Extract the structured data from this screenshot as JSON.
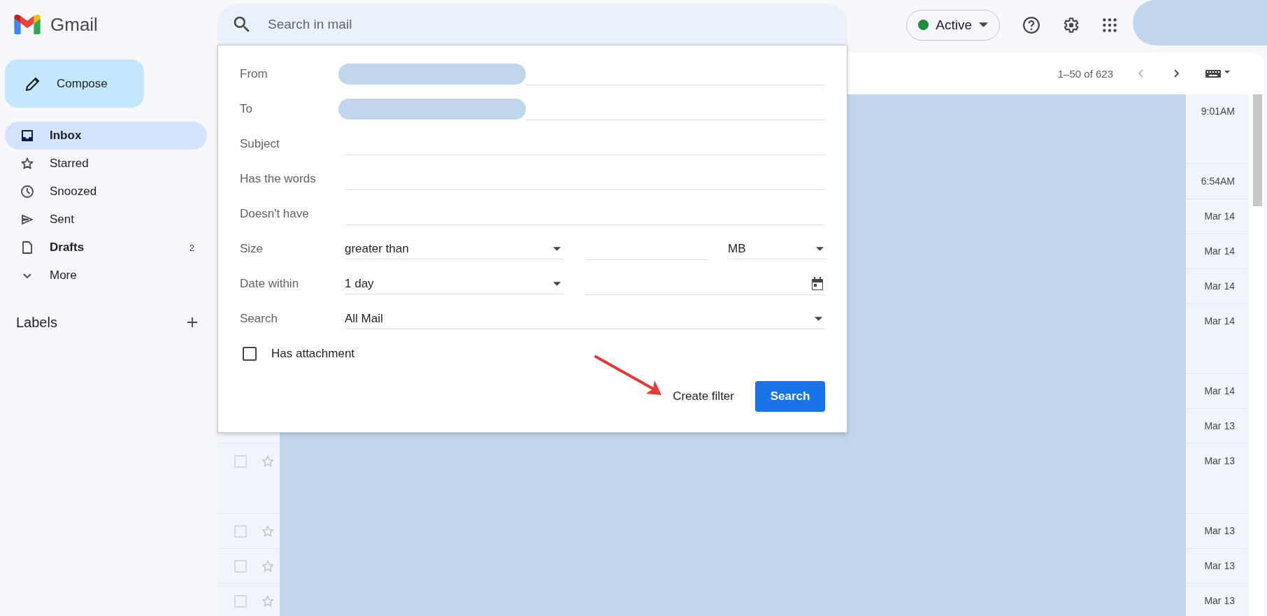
{
  "app": {
    "name": "Gmail"
  },
  "search": {
    "placeholder": "Search in mail"
  },
  "status": {
    "label": "Active"
  },
  "compose": {
    "label": "Compose"
  },
  "nav": [
    {
      "label": "Inbox",
      "selected": true,
      "bold": true
    },
    {
      "label": "Starred",
      "selected": false,
      "bold": false
    },
    {
      "label": "Snoozed",
      "selected": false,
      "bold": false
    },
    {
      "label": "Sent",
      "selected": false,
      "bold": false
    },
    {
      "label": "Drafts",
      "selected": false,
      "bold": true,
      "count": "2"
    },
    {
      "label": "More",
      "selected": false,
      "bold": false
    }
  ],
  "labels": {
    "title": "Labels"
  },
  "toolbar": {
    "range": "1–50 of 623"
  },
  "rows_under_dialog": [
    {
      "date": "9:01AM",
      "tall": true
    },
    {
      "date": "6:54AM",
      "tall": false
    },
    {
      "date": "Mar 14",
      "tall": false
    },
    {
      "date": "Mar 14",
      "tall": false
    },
    {
      "date": "Mar 14",
      "tall": false
    },
    {
      "date": "Mar 14",
      "tall": true
    },
    {
      "date": "Mar 14",
      "tall": false
    },
    {
      "date": "Mar 13",
      "tall": false
    }
  ],
  "rows": [
    {
      "date": "Mar 13",
      "tall": true
    },
    {
      "date": "Mar 13",
      "tall": false
    },
    {
      "date": "Mar 13",
      "tall": false
    },
    {
      "date": "Mar 13",
      "tall": false
    }
  ],
  "filter_dialog": {
    "fields": [
      {
        "label": "From",
        "kind": "text",
        "redacted": true
      },
      {
        "label": "To",
        "kind": "text",
        "redacted": true
      },
      {
        "label": "Subject",
        "kind": "text",
        "redacted": false
      },
      {
        "label": "Has the words",
        "kind": "text",
        "redacted": false
      },
      {
        "label": "Doesn't have",
        "kind": "text",
        "redacted": false
      },
      {
        "label": "Size",
        "kind": "size",
        "value": "greater than",
        "unit": "MB"
      },
      {
        "label": "Date within",
        "kind": "date",
        "value": "1 day"
      },
      {
        "label": "Search",
        "kind": "select",
        "value": "All Mail"
      }
    ],
    "has_attachment": {
      "label": "Has attachment",
      "checked": false
    },
    "create_filter": "Create filter",
    "search_button": "Search",
    "arrow_annotation": true
  }
}
